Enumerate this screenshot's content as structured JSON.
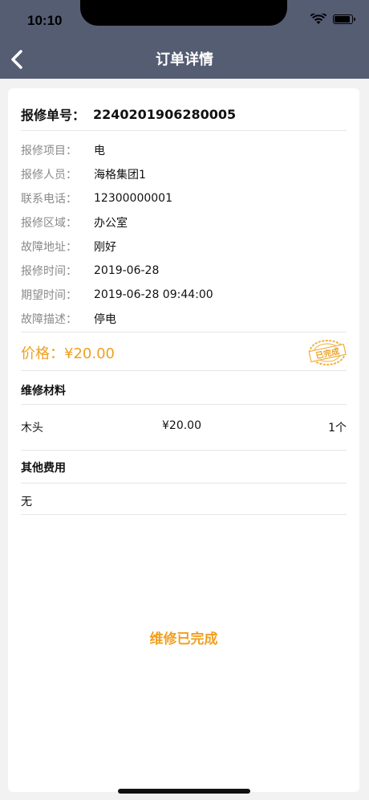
{
  "status_bar": {
    "time": "10:10"
  },
  "nav": {
    "title": "订单详情",
    "back_icon": "chevron-left-icon"
  },
  "order": {
    "number_label": "报修单号：",
    "number_value": "2240201906280005"
  },
  "info": [
    {
      "label": "报修项目：",
      "value": "电"
    },
    {
      "label": "报修人员：",
      "value": "海格集团1"
    },
    {
      "label": "联系电话：",
      "value": "12300000001"
    },
    {
      "label": "报修区域：",
      "value": "办公室"
    },
    {
      "label": "故障地址：",
      "value": "刚好"
    },
    {
      "label": "报修时间：",
      "value": "2019-06-28"
    },
    {
      "label": "期望时间：",
      "value": "2019-06-28 09:44:00"
    },
    {
      "label": "故障描述：",
      "value": "停电"
    }
  ],
  "price": {
    "text": "价格：¥20.00",
    "stamp_text": "已完成"
  },
  "materials": {
    "title": "维修材料",
    "items": [
      {
        "name": "木头",
        "price": "¥20.00",
        "qty": "1个"
      }
    ]
  },
  "other_fees": {
    "title": "其他费用",
    "value": "无"
  },
  "status_action": "维修已完成",
  "colors": {
    "header": "#555d73",
    "accent": "#f0a020"
  }
}
